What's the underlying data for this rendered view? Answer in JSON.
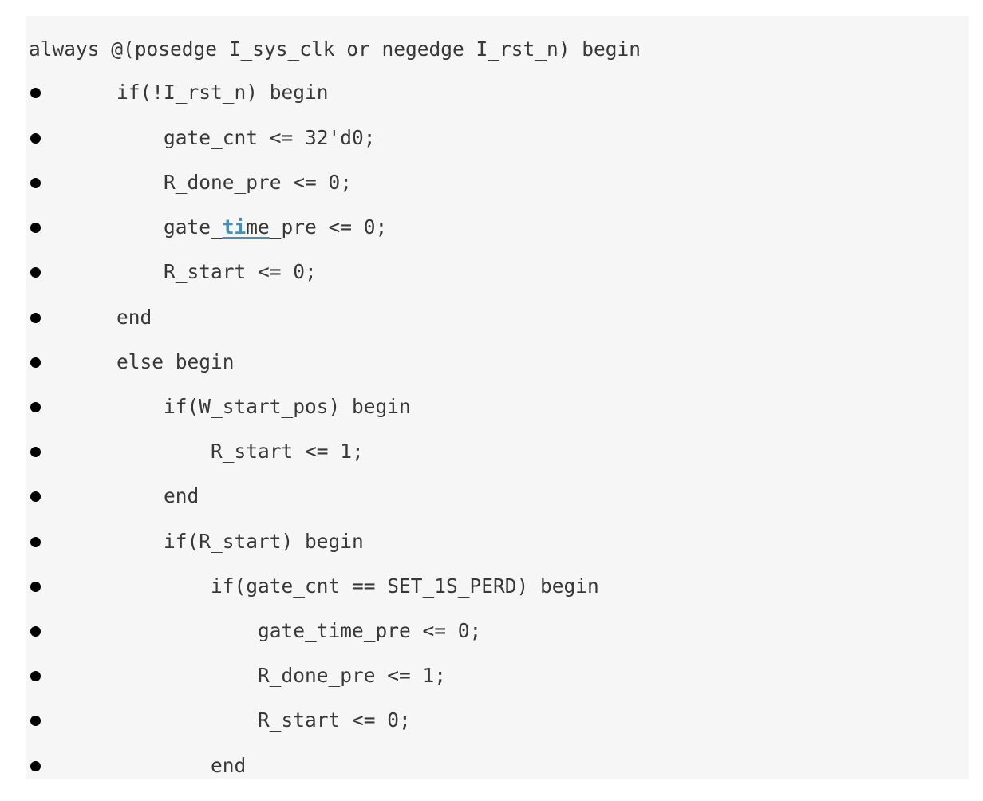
{
  "code": {
    "line_0": "always @(posedge I_sys_clk or negedge I_rst_n) begin",
    "line_1": "if(!I_rst_n) begin",
    "line_2": "gate_cnt <= 32'd0;",
    "line_3": "R_done_pre <= 0;",
    "line_4_before": "gate_",
    "line_4_highlight": "ti",
    "line_4_highlight_tail": "me",
    "line_4_after": "_pre <= 0;",
    "line_5": "R_start <= 0;",
    "line_6": "end",
    "line_7": "else begin",
    "line_8": "if(W_start_pos) begin",
    "line_9": "R_start <= 1;",
    "line_10": "end",
    "line_11": "if(R_start) begin",
    "line_12": "if(gate_cnt == SET_1S_PERD) begin",
    "line_13": "gate_time_pre <= 0;",
    "line_14": "R_done_pre <= 1;",
    "line_15": "R_start <= 0;",
    "line_16": "end"
  },
  "colors": {
    "code_background": "#f6f6f6",
    "code_text": "#383838",
    "highlight": "#4a8db5",
    "bullet": "#000000"
  }
}
